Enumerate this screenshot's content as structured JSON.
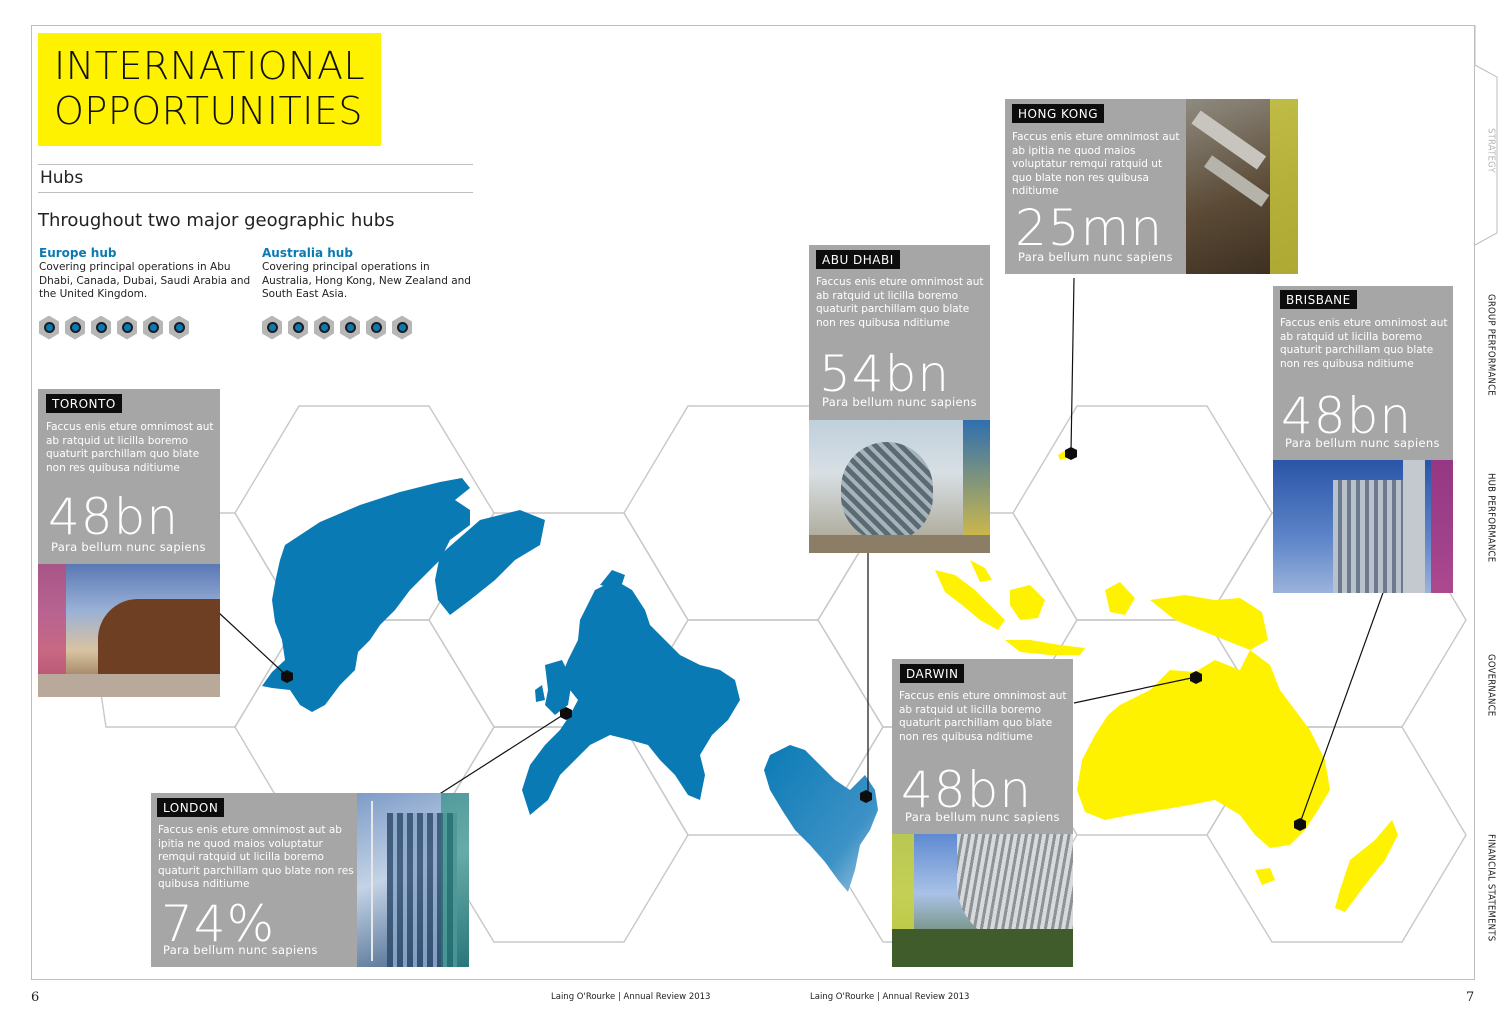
{
  "title": {
    "line1": "INTERNATIONAL",
    "line2": "OPPORTUNITIES"
  },
  "section_label": "Hubs",
  "intro": "Throughout two major geographic hubs",
  "hubs": [
    {
      "title": "Europe hub",
      "text": "Covering principal operations in Abu Dhabi, Canada, Dubai, Saudi Arabia and the United Kingdom."
    },
    {
      "title": "Australia hub",
      "text": "Covering principal operations in Australia, Hong Kong, New Zealand and South East Asia."
    }
  ],
  "hub_icons": [
    "building-icon",
    "engineer-icon",
    "pipe-icon",
    "crane-icon",
    "ship-icon",
    "bell-icon"
  ],
  "side_tabs": [
    "STRATEGY",
    "GROUP PERFORMANCE",
    "HUB PERFORMANCE",
    "GOVERNANCE",
    "FINANCIAL STATEMENTS"
  ],
  "cards": {
    "toronto": {
      "city": "TORONTO",
      "text": "Faccus enis eture omnimost aut ab ratquid ut licilla boremo quaturit parchillam quo blate non res quibusa nditiume",
      "figure": "48bn",
      "caption": "Para bellum nunc sapiens"
    },
    "london": {
      "city": "LONDON",
      "text": "Faccus enis eture omnimost aut ab ipitia ne quod maios voluptatur remqui ratquid ut licilla boremo quaturit parchillam quo blate non res quibusa nditiume",
      "figure": "74%",
      "caption": "Para bellum nunc sapiens"
    },
    "abu_dhabi": {
      "city": "ABU DHABI",
      "text": "Faccus enis eture omnimost aut ab ratquid ut licilla boremo quaturit parchillam quo blate non res quibusa nditiume",
      "figure": "54bn",
      "caption": "Para bellum nunc sapiens"
    },
    "hong_kong": {
      "city": "HONG KONG",
      "text": "Faccus enis eture omnimost aut ab ipitia ne quod maios voluptatur remqui ratquid ut quo blate non res quibusa nditiume",
      "figure": "25mn",
      "caption": "Para bellum nunc sapiens"
    },
    "brisbane": {
      "city": "BRISBANE",
      "text": "Faccus enis eture omnimost aut ab ratquid ut licilla boremo quaturit parchillam quo blate non res quibusa nditiume",
      "figure": "48bn",
      "caption": "Para bellum nunc sapiens"
    },
    "darwin": {
      "city": "DARWIN",
      "text": "Faccus enis eture omnimost aut ab ratquid ut licilla boremo quaturit parchillam quo blate non res quibusa nditiume",
      "figure": "48bn",
      "caption": "Para bellum nunc sapiens"
    }
  },
  "footer": {
    "page_left": "6",
    "page_right": "7",
    "text_left": "Laing O'Rourke | Annual Review 2013",
    "text_right": "Laing O'Rourke | Annual Review 2013"
  },
  "colors": {
    "title_bg": "#fff200",
    "europe_hub": "#0a7ab5",
    "australia_hub": "#fff200",
    "card_bg": "#a6a6a6",
    "tag_bg": "#0d0d0d"
  }
}
